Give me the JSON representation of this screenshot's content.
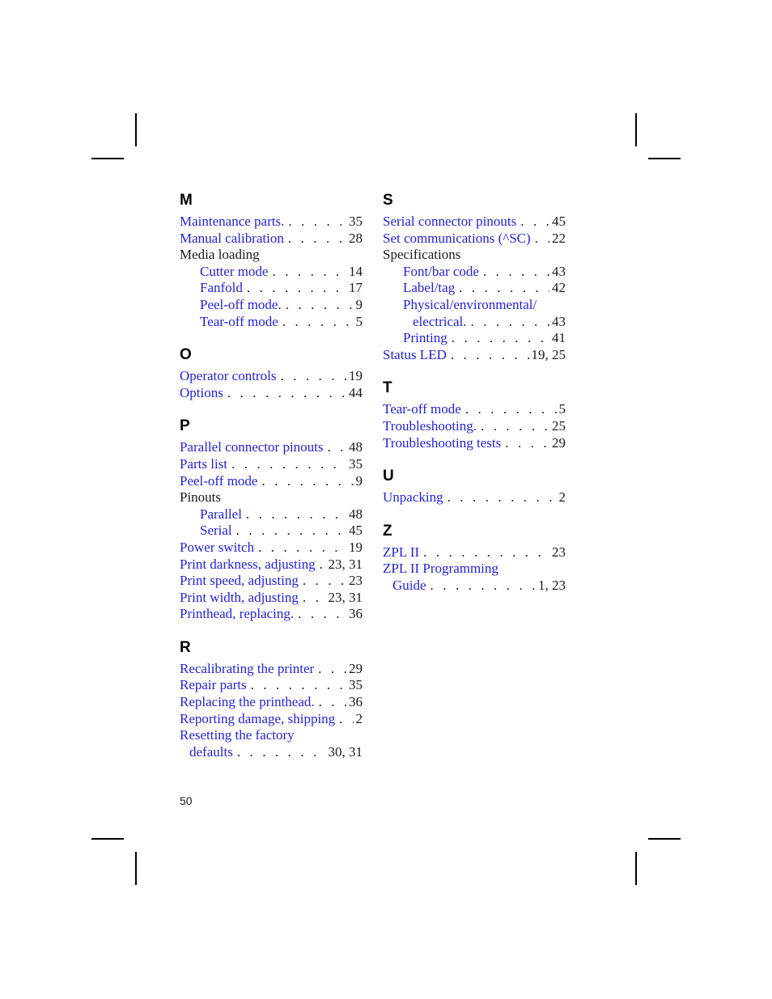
{
  "document": {
    "folio": "50",
    "link_color": "#2222dd",
    "text_color": "#1a1a1a"
  },
  "columns": {
    "left": [
      {
        "letter": "M",
        "entries": [
          {
            "label": "Maintenance parts.",
            "page": "35",
            "style": "link",
            "level": 0
          },
          {
            "label": "Manual calibration",
            "page": "28",
            "style": "link",
            "level": 0
          },
          {
            "label": "Media loading",
            "page": "",
            "style": "plain",
            "level": 0,
            "no_leader": true
          },
          {
            "label": "Cutter mode",
            "page": "14",
            "style": "link",
            "level": 1
          },
          {
            "label": "Fanfold",
            "page": "17",
            "style": "link",
            "level": 1
          },
          {
            "label": "Peel-off mode.",
            "page": "9",
            "style": "link",
            "level": 1
          },
          {
            "label": "Tear-off mode",
            "page": "5",
            "style": "link",
            "level": 1
          }
        ]
      },
      {
        "letter": "O",
        "entries": [
          {
            "label": "Operator controls",
            "page": "19",
            "style": "link",
            "level": 0
          },
          {
            "label": "Options",
            "page": "44",
            "style": "link",
            "level": 0
          }
        ]
      },
      {
        "letter": "P",
        "entries": [
          {
            "label": "Parallel connector pinouts",
            "page": "48",
            "style": "link",
            "level": 0
          },
          {
            "label": "Parts list",
            "page": "35",
            "style": "link",
            "level": 0
          },
          {
            "label": "Peel-off mode",
            "page": "9",
            "style": "link",
            "level": 0
          },
          {
            "label": "Pinouts",
            "page": "",
            "style": "plain",
            "level": 0,
            "no_leader": true
          },
          {
            "label": "Parallel",
            "page": "48",
            "style": "link",
            "level": 1
          },
          {
            "label": "Serial",
            "page": "45",
            "style": "link",
            "level": 1
          },
          {
            "label": "Power switch",
            "page": "19",
            "style": "link",
            "level": 0
          },
          {
            "label": "Print darkness, adjusting",
            "page": "23, 31",
            "style": "link",
            "level": 0
          },
          {
            "label": "Print speed, adjusting",
            "page": "23",
            "style": "link",
            "level": 0
          },
          {
            "label": "Print width, adjusting",
            "page": "23, 31",
            "style": "link",
            "level": 0
          },
          {
            "label": "Printhead, replacing.",
            "page": "36",
            "style": "link",
            "level": 0
          }
        ]
      },
      {
        "letter": "R",
        "entries": [
          {
            "label": "Recalibrating the printer",
            "page": "29",
            "style": "link",
            "level": 0
          },
          {
            "label": "Repair parts",
            "page": "35",
            "style": "link",
            "level": 0
          },
          {
            "label": "Replacing the printhead.",
            "page": "36",
            "style": "link",
            "level": 0
          },
          {
            "label": "Reporting damage, shipping",
            "page": "2",
            "style": "link",
            "level": 0
          },
          {
            "label": "Resetting the factory",
            "page": "",
            "style": "link",
            "level": 0,
            "no_leader": true,
            "wrap_head": true
          },
          {
            "label": "defaults",
            "page": "30, 31",
            "style": "link",
            "level": 0,
            "continuation": true
          }
        ]
      }
    ],
    "right": [
      {
        "letter": "S",
        "entries": [
          {
            "label": "Serial connector pinouts",
            "page": "45",
            "style": "link",
            "level": 0
          },
          {
            "label": "Set communications (^SC)",
            "page": "22",
            "style": "link",
            "level": 0
          },
          {
            "label": "Specifications",
            "page": "",
            "style": "plain",
            "level": 0,
            "no_leader": true
          },
          {
            "label": "Font/bar code",
            "page": "43",
            "style": "link",
            "level": 1
          },
          {
            "label": "Label/tag",
            "page": "42",
            "style": "link",
            "level": 1
          },
          {
            "label": "Physical/environmental/",
            "page": "",
            "style": "link",
            "level": 1,
            "no_leader": true,
            "wrap_head": true
          },
          {
            "label": "electrical.",
            "page": "43",
            "style": "link",
            "level": 1,
            "continuation": true
          },
          {
            "label": "Printing",
            "page": "41",
            "style": "link",
            "level": 1
          },
          {
            "label": "Status LED",
            "page": "19, 25",
            "style": "link",
            "level": 0
          }
        ]
      },
      {
        "letter": "T",
        "entries": [
          {
            "label": "Tear-off mode",
            "page": "5",
            "style": "link",
            "level": 0
          },
          {
            "label": "Troubleshooting.",
            "page": "25",
            "style": "link",
            "level": 0
          },
          {
            "label": "Troubleshooting tests",
            "page": "29",
            "style": "link",
            "level": 0
          }
        ]
      },
      {
        "letter": "U",
        "entries": [
          {
            "label": "Unpacking",
            "page": "2",
            "style": "link",
            "level": 0
          }
        ]
      },
      {
        "letter": "Z",
        "entries": [
          {
            "label": "ZPL II",
            "page": "23",
            "style": "link",
            "level": 0
          },
          {
            "label": "ZPL II Programming",
            "page": "",
            "style": "link",
            "level": 0,
            "no_leader": true,
            "wrap_head": true
          },
          {
            "label": "Guide",
            "page": "1, 23",
            "style": "link",
            "level": 0,
            "continuation": true
          }
        ]
      }
    ]
  }
}
